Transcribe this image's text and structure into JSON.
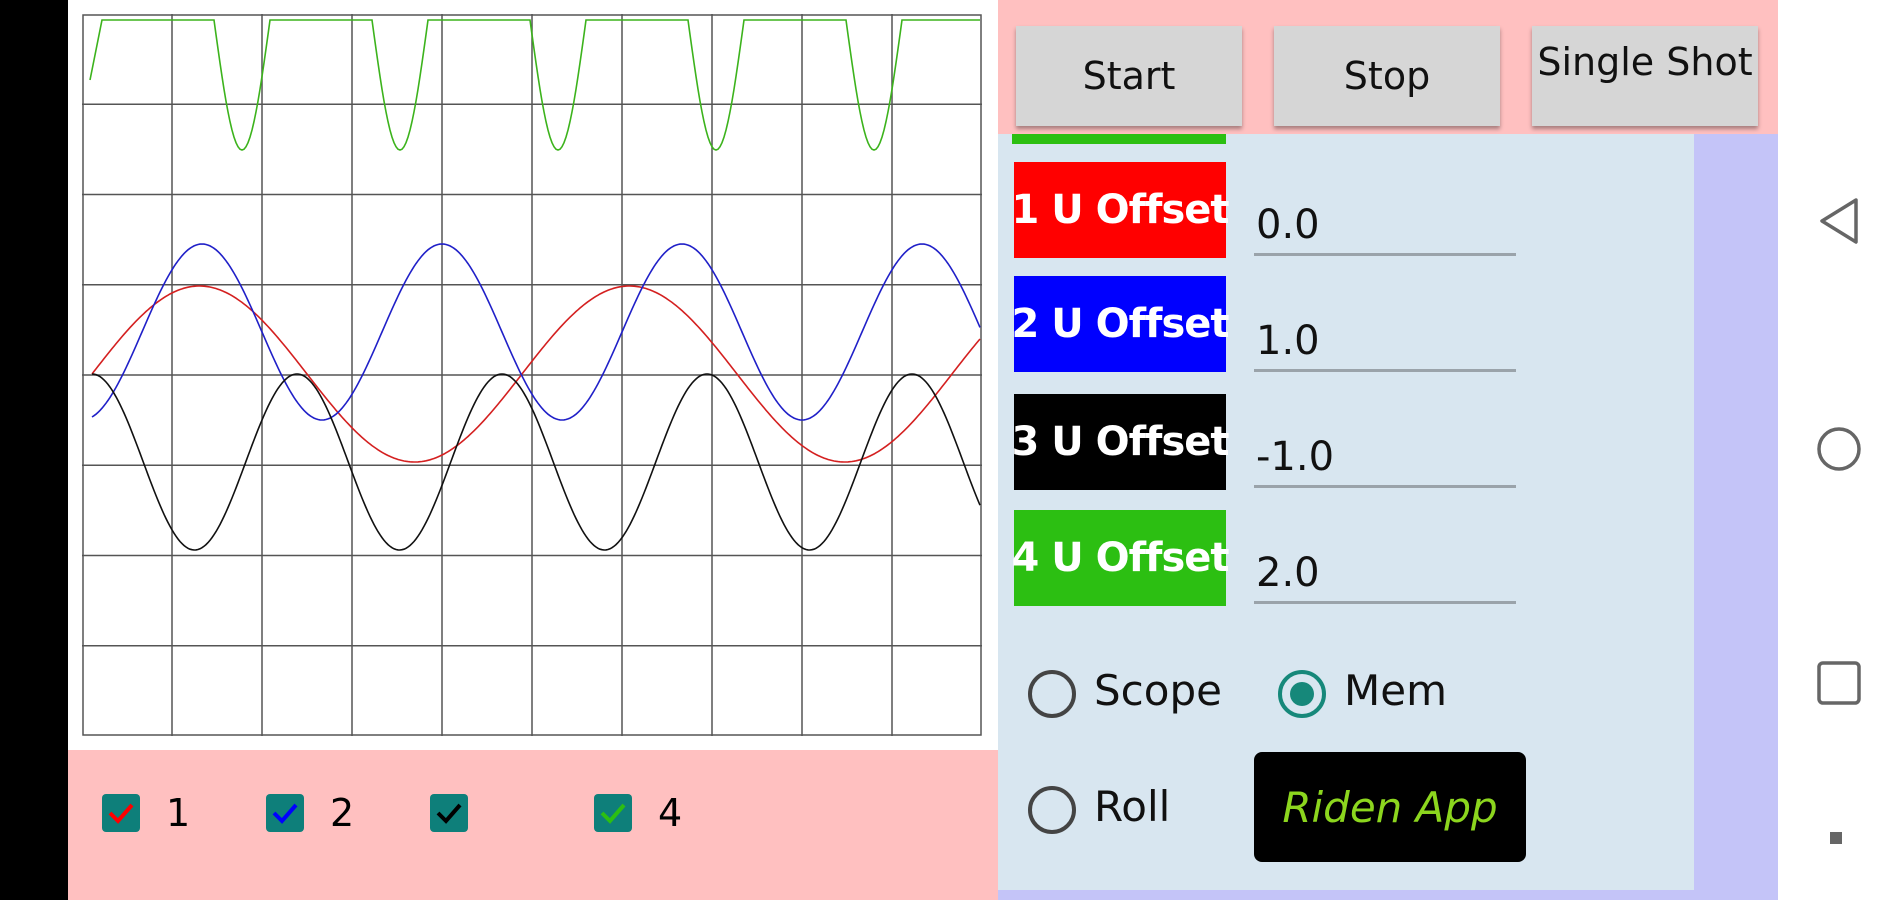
{
  "toolbar": {
    "start_label": "Start",
    "stop_label": "Stop",
    "single_shot_label": "Single Shot"
  },
  "offsets": [
    {
      "label": "1 U Offset",
      "value": "0.0",
      "color": "#ff0000"
    },
    {
      "label": "2 U Offset",
      "value": "1.0",
      "color": "#0000ff"
    },
    {
      "label": "3 U Offset",
      "value": "-1.0",
      "color": "#000000"
    },
    {
      "label": "4 U Offset",
      "value": "2.0",
      "color": "#2cbf12"
    }
  ],
  "modes": {
    "scope_label": "Scope",
    "mem_label": "Mem",
    "roll_label": "Roll",
    "selected": "Mem"
  },
  "riden_button_label": "Riden App",
  "channels": [
    {
      "label": "1",
      "color": "#ff0000",
      "checked": true
    },
    {
      "label": "2",
      "color": "#0000ff",
      "checked": true
    },
    {
      "label": "",
      "color": "#000000",
      "checked": true
    },
    {
      "label": "4",
      "color": "#2cbf12",
      "checked": true
    }
  ],
  "nav": {
    "back_icon": "back-triangle-icon",
    "home_icon": "home-circle-icon",
    "recents_icon": "recents-square-icon"
  },
  "colors": {
    "toolbar_bg": "#ffc0c0",
    "panel_bg": "#d8e6f0",
    "accent_radio": "#16887a",
    "riden_text": "#8cd61e"
  }
}
